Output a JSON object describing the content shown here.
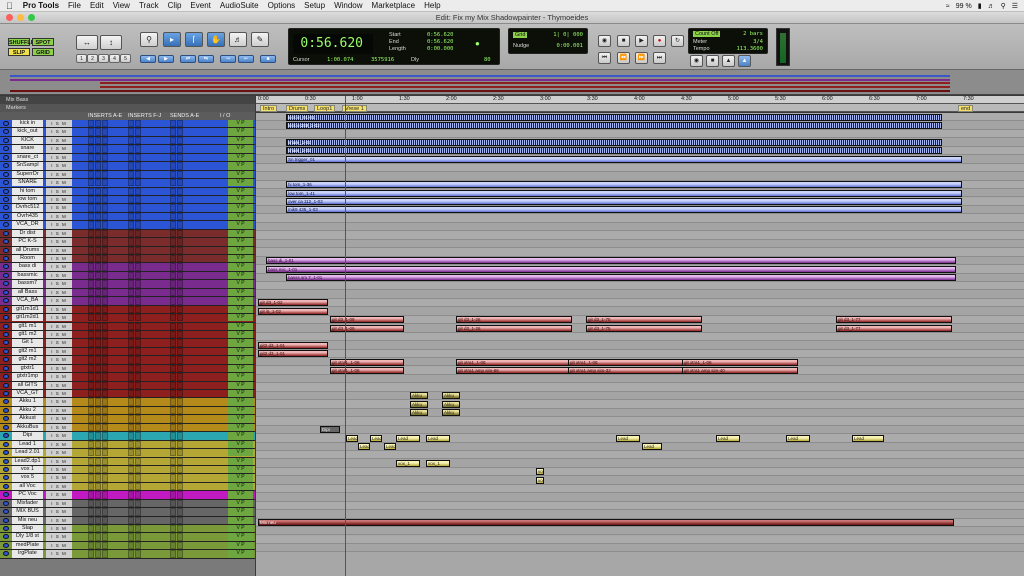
{
  "menubar": {
    "app": "Pro Tools",
    "menus": [
      "File",
      "Edit",
      "View",
      "Track",
      "Clip",
      "Event",
      "AudioSuite",
      "Options",
      "Setup",
      "Window",
      "Marketplace",
      "Help"
    ],
    "battery": "99 %"
  },
  "window": {
    "title": "Edit: Fix my Mix Shadowpainter - Thymoeides"
  },
  "toolbar": {
    "modes": [
      "SHUFFLE",
      "SPOT",
      "SLIP",
      "GRID"
    ],
    "zoom_presets": [
      "1",
      "2",
      "3",
      "4",
      "5"
    ],
    "counter": {
      "main": "0:56.620",
      "start_label": "Start",
      "start": "0:56.620",
      "end_label": "End",
      "end": "0:56.620",
      "length_label": "Length",
      "length": "0:00.000",
      "cursor_label": "Cursor",
      "cursor": "1:00.074",
      "sample": "3575916",
      "dly": "Dly",
      "grid_val": "80"
    },
    "nudge": {
      "grid_label": "Grid",
      "grid": "1| 0| 000",
      "nudge_label": "Nudge",
      "nudge": "0:00.001"
    },
    "countoff": {
      "countoff_label": "Count Off",
      "countoff": "2 bars",
      "meter_label": "Meter",
      "meter": "3/4",
      "tempo_label": "Tempo",
      "tempo": "113.3600"
    }
  },
  "tracklist": {
    "header": "Mix Bass",
    "markers_label": "Markers",
    "columns": [
      "INSERTS A-E",
      "INSERTS F-J",
      "SENDS A-E",
      "I / O"
    ],
    "tracks": [
      {
        "name": "kick in",
        "color": "#2c55d6"
      },
      {
        "name": "kick_out",
        "color": "#2c55d6"
      },
      {
        "name": "KICK",
        "color": "#2c55d6"
      },
      {
        "name": "snare",
        "color": "#2c55d6"
      },
      {
        "name": "snare_ct",
        "color": "#2c55d6"
      },
      {
        "name": "SnSampl",
        "color": "#2c55d6"
      },
      {
        "name": "SuperrDr",
        "color": "#2c55d6"
      },
      {
        "name": "SNARE",
        "color": "#2c55d6"
      },
      {
        "name": "hi tom",
        "color": "#2c55d6"
      },
      {
        "name": "low tom",
        "color": "#2c55d6"
      },
      {
        "name": "Ovrhc512",
        "color": "#2c55d6"
      },
      {
        "name": "Ovrh435",
        "color": "#2c55d6"
      },
      {
        "name": "VCA_DR",
        "color": "#2c55d6"
      },
      {
        "name": "Dr dist",
        "color": "#7a2b2b"
      },
      {
        "name": "PC K-S",
        "color": "#7a2b2b"
      },
      {
        "name": "all Drums",
        "color": "#7a2b2b"
      },
      {
        "name": "Room",
        "color": "#7a2b2b"
      },
      {
        "name": "bass di",
        "color": "#7a2b8e"
      },
      {
        "name": "bassmic",
        "color": "#7a2b8e"
      },
      {
        "name": "bassm7",
        "color": "#7a2b8e"
      },
      {
        "name": "all Bass",
        "color": "#7a2b8e"
      },
      {
        "name": "VCA_BA",
        "color": "#7a2b8e"
      },
      {
        "name": "git1m1d1",
        "color": "#8e1f1f"
      },
      {
        "name": "git1m2d1",
        "color": "#8e1f1f"
      },
      {
        "name": "glt1 m1",
        "color": "#8e1f1f"
      },
      {
        "name": "glt1 m2",
        "color": "#8e1f1f"
      },
      {
        "name": "Git 1",
        "color": "#8e1f1f"
      },
      {
        "name": "glt2 m1",
        "color": "#8e1f1f"
      },
      {
        "name": "glt2 m2",
        "color": "#8e1f1f"
      },
      {
        "name": "gtxtr1",
        "color": "#8e1f1f"
      },
      {
        "name": "gtxtr1mp",
        "color": "#8e1f1f"
      },
      {
        "name": "all GITS",
        "color": "#8e1f1f"
      },
      {
        "name": "VCA_GT",
        "color": "#8e1f1f"
      },
      {
        "name": "Akku 1",
        "color": "#b48a1a"
      },
      {
        "name": "Akku 2",
        "color": "#b48a1a"
      },
      {
        "name": "Akkust",
        "color": "#b48a1a"
      },
      {
        "name": "AkkuBus",
        "color": "#b48a1a"
      },
      {
        "name": "Dipi",
        "color": "#2aa7b0"
      },
      {
        "name": "Lead 1",
        "color": "#b4a736"
      },
      {
        "name": "Lead 2.01",
        "color": "#b4a736"
      },
      {
        "name": "Lead2.dp1",
        "color": "#b4a736"
      },
      {
        "name": "vox 1",
        "color": "#b4a736"
      },
      {
        "name": "vox 5",
        "color": "#b4a736"
      },
      {
        "name": "all Voc",
        "color": "#b4a736"
      },
      {
        "name": "PC Voc",
        "color": "#c21ac2"
      },
      {
        "name": "Mixfader",
        "color": "#666666"
      },
      {
        "name": "MIX BUS",
        "color": "#666666"
      },
      {
        "name": "Mix neu",
        "color": "#666666"
      },
      {
        "name": "Slap",
        "color": "#7a9a3a"
      },
      {
        "name": "Dly 1/8 st",
        "color": "#7a9a3a"
      },
      {
        "name": "medPlate",
        "color": "#7a9a3a"
      },
      {
        "name": "lrgPlate",
        "color": "#7a9a3a"
      }
    ]
  },
  "ruler": {
    "ticks": [
      "0:00",
      "0:30",
      "1:00",
      "1:30",
      "2:00",
      "2:30",
      "3:00",
      "3:30",
      "4:00",
      "4:30",
      "5:00",
      "5:30",
      "6:00",
      "6:30",
      "7:00",
      "7:30"
    ]
  },
  "markers": [
    "Intro",
    "Drums",
    "Loop1",
    "Vrese 1",
    "end"
  ],
  "clips": {
    "kick_in": "kick in_01-01",
    "kick_out": "kick o 289_1-02",
    "snare": "snare_1-02",
    "sn_trigger": "Sn trigger_01",
    "hi_tom": "hi tom_1-36",
    "low_tom": "low tom_1-41",
    "overhead": "over ca 112_1-02",
    "ohr": "mik9 435_1-03",
    "bass_di": "bass di_1-01",
    "bass_mic": "bass mic_1-01",
    "bass_sm7": "basss sm 7_1-01",
    "git_d3": "git d3_1-02",
    "git_i5": "git i5_1-02",
    "git_d3b": "git d3_1-09",
    "git_d3c": "git d3_1-26",
    "git_d3d": "git d3_1-75",
    "git_d3e": "git d3_1-77",
    "git2": "git2 d3_1-01",
    "gitxtra": "git xtra1_1-08",
    "gitxtra_amp": "git xtra1 amp sim-66",
    "gitxtra_amp2": "git xtra1 amp sim-32",
    "gitxtra_amp3": "git xtra1 amp sim-40",
    "akku": "Akku",
    "dipi": "Dipi",
    "lead": "Lead",
    "vox": "vox_1",
    "mix_neu": "Mix neu"
  }
}
